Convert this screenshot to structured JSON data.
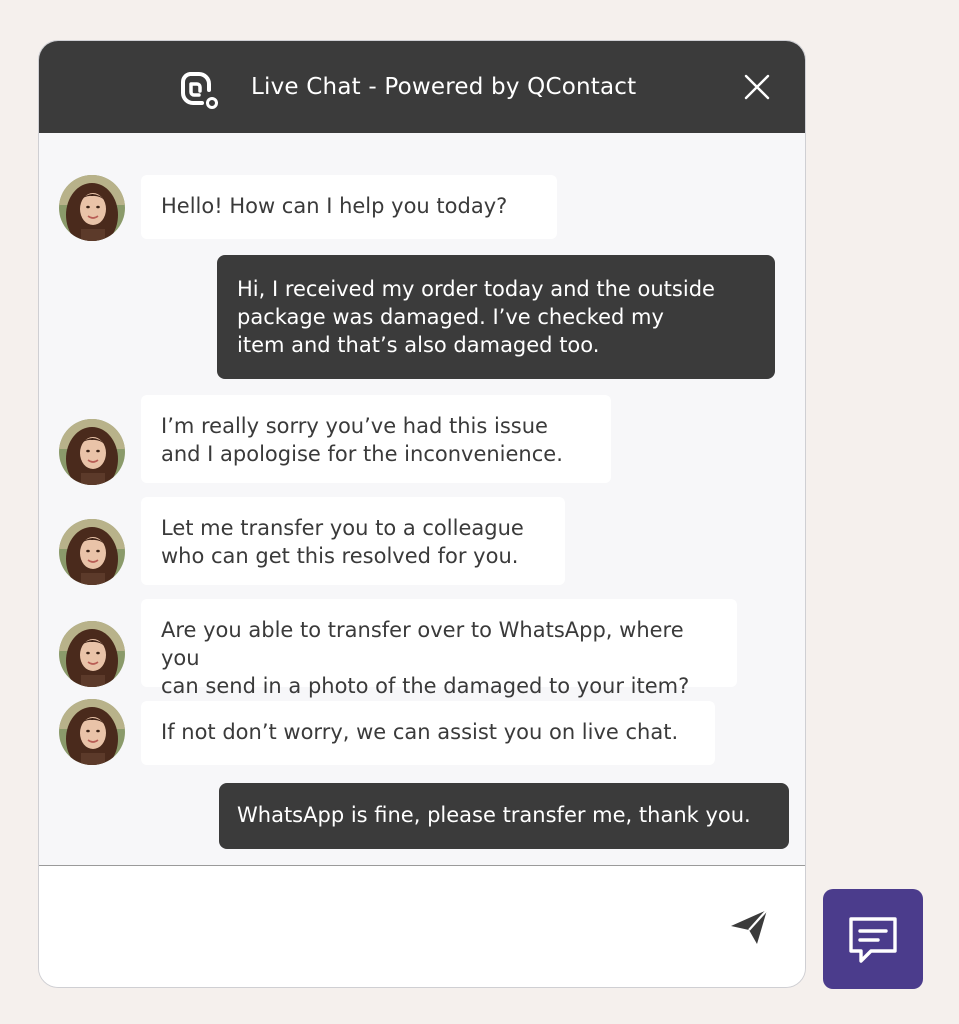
{
  "header": {
    "title": "Live Chat - Powered by QContact",
    "logo_icon": "qcontact-logo-icon",
    "close_icon": "close-icon"
  },
  "messages": [
    {
      "sender": "agent",
      "text": "Hello! How can I help you today?"
    },
    {
      "sender": "user",
      "text": "Hi, I received my order today and the outside\npackage was damaged. I’ve checked my\nitem and that’s also damaged too."
    },
    {
      "sender": "agent",
      "text": "I’m really sorry you’ve had this issue\nand I apologise for the inconvenience."
    },
    {
      "sender": "agent",
      "text": "Let me transfer you to a colleague\nwho can get this resolved for you."
    },
    {
      "sender": "agent",
      "text": "Are you able to transfer over to WhatsApp, where you\ncan send in a photo of the damaged to your item?"
    },
    {
      "sender": "agent",
      "text": "If not don’t worry, we can assist you on live chat."
    },
    {
      "sender": "user",
      "text": "WhatsApp is fine, please transfer me, thank you."
    }
  ],
  "composer": {
    "value": "",
    "placeholder": "",
    "send_icon": "send-icon"
  },
  "launcher": {
    "icon": "chat-bubble-icon"
  },
  "colors": {
    "header_bg": "#3b3b3b",
    "user_bubble_bg": "#3b3b3b",
    "agent_bubble_bg": "#ffffff",
    "chat_bg": "#f7f7f9",
    "page_bg": "#f5f0ed",
    "launcher_bg": "#4b3c8c"
  }
}
